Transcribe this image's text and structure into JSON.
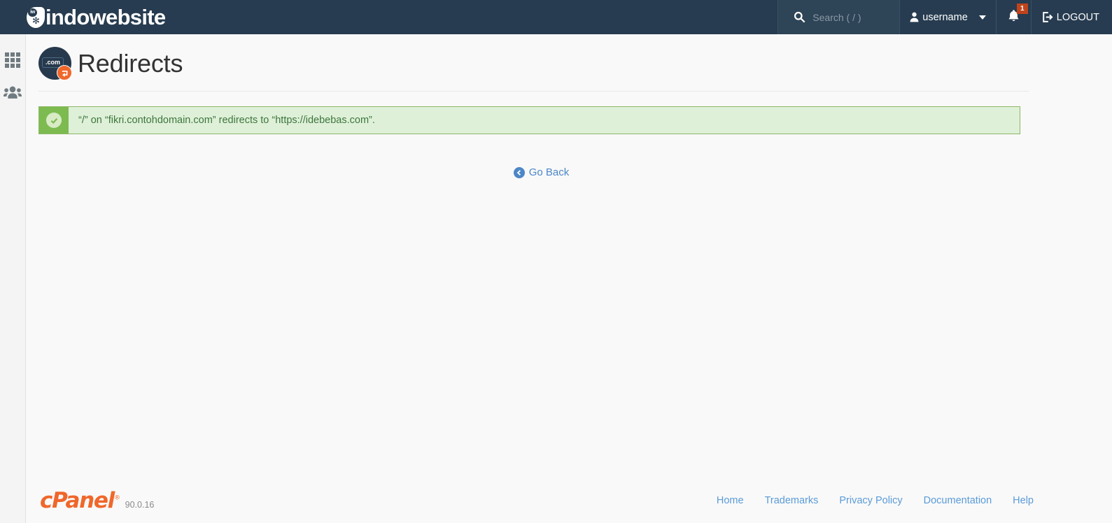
{
  "header": {
    "brand": {
      "logo_initials": "iw",
      "logo_icon": "leaf-drop-icon",
      "name": "indowebsite"
    },
    "search": {
      "icon": "search-icon",
      "placeholder": "Search ( / )",
      "value": ""
    },
    "user": {
      "icon": "user-icon",
      "label": "username",
      "caret": "chevron-down-icon"
    },
    "notifications": {
      "icon": "bell-icon",
      "count": "1"
    },
    "logout": {
      "icon": "sign-out-icon",
      "label": "LOGOUT"
    },
    "colors": {
      "masthead_bg": "#273c50",
      "search_bg": "#2e4457",
      "badge_bg": "#c0441c"
    }
  },
  "sidebar": {
    "items": [
      {
        "name": "home-apps",
        "icon": "grid-icon"
      },
      {
        "name": "user-manager",
        "icon": "users-icon"
      }
    ]
  },
  "page": {
    "icon": {
      "name": "domain-redirect-icon",
      "label": ".com",
      "badge_icon": "redirect-arrow-icon",
      "badge_color": "#f0672b"
    },
    "title": "Redirects"
  },
  "alert": {
    "type": "success",
    "icon": "check-circle-icon",
    "message": "“/” on “fikri.contohdomain.com” redirects to “https://idebebas.com”.",
    "colors": {
      "bg": "#dff0d8",
      "border": "#8cb866",
      "icon_bg": "#7dbb51",
      "text": "#3c763d"
    }
  },
  "actions": {
    "go_back": {
      "icon": "arrow-circle-left-icon",
      "label": "Go Back"
    }
  },
  "footer": {
    "logo_text": "cPanel",
    "logo_trademark": "®",
    "version": "90.0.16",
    "links": [
      {
        "label": "Home"
      },
      {
        "label": "Trademarks"
      },
      {
        "label": "Privacy Policy"
      },
      {
        "label": "Documentation"
      },
      {
        "label": "Help"
      }
    ]
  }
}
